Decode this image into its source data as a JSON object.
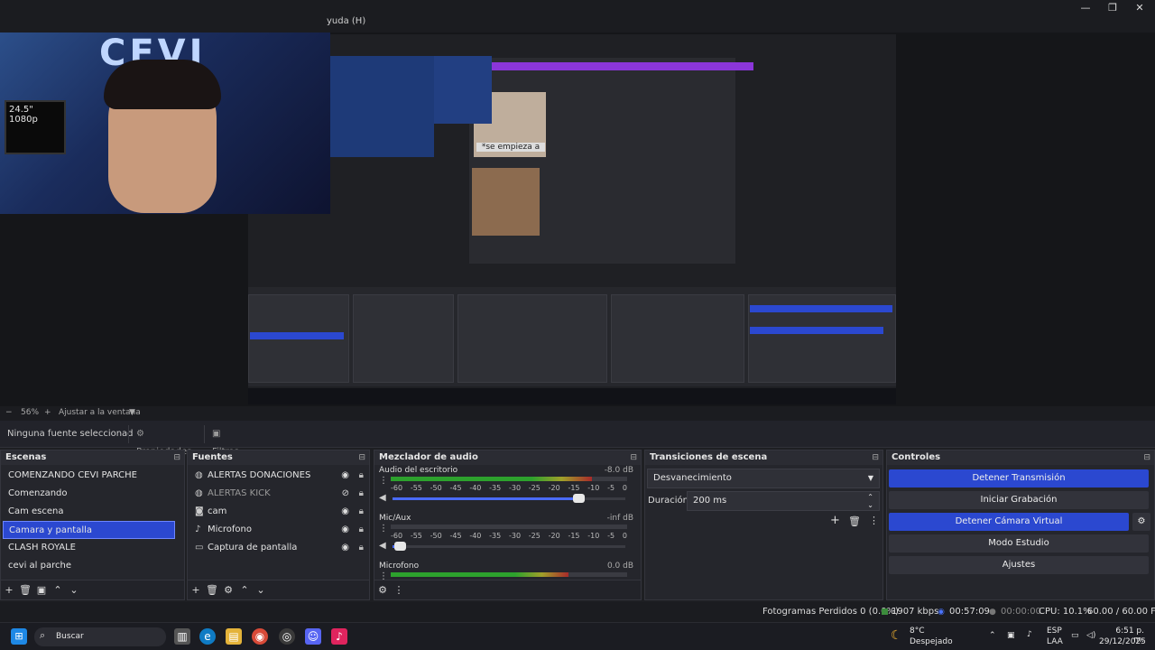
{
  "window": {
    "title_menu_partial": "yuda (H)",
    "controls": [
      "—",
      "❐",
      "✕"
    ]
  },
  "preview": {
    "webcam_overlay_text": "24.5\" 1080p",
    "logo_text": "CEVI",
    "meme_caption": "*se empieza a"
  },
  "zoom_bar": {
    "minus": "−",
    "zoom": "56%",
    "plus": "+",
    "fit_label": "Ajustar a la ventana",
    "dropdown": "▼"
  },
  "source_toolbar": {
    "no_source": "Ninguna fuente seleccionad",
    "properties": "Propiedades",
    "filters": "Filtros"
  },
  "scenes": {
    "title": "Escenas",
    "items": [
      {
        "label": "COMENZANDO CEVI PARCHE"
      },
      {
        "label": "Comenzando"
      },
      {
        "label": "Cam escena"
      },
      {
        "label": "Camara y pantalla"
      },
      {
        "label": "CLASH ROYALE"
      },
      {
        "label": "cevi al parche"
      }
    ],
    "selected": "Camara y pantalla"
  },
  "sources": {
    "title": "Fuentes",
    "items": [
      {
        "label": "ALERTAS DONACIONES",
        "icon": "globe-icon",
        "visible": true
      },
      {
        "label": "ALERTAS KICK",
        "icon": "globe-icon",
        "visible": false
      },
      {
        "label": "cam",
        "icon": "camera-icon",
        "visible": true
      },
      {
        "label": "Microfono",
        "icon": "microphone-icon",
        "visible": true
      },
      {
        "label": "Captura de pantalla",
        "icon": "monitor-icon",
        "visible": true
      }
    ]
  },
  "mixer": {
    "title": "Mezclador de audio",
    "ticks": [
      "-60",
      "-55",
      "-50",
      "-45",
      "-40",
      "-35",
      "-30",
      "-25",
      "-20",
      "-15",
      "-10",
      "-5",
      "0"
    ],
    "channels": [
      {
        "name": "Audio del escritorio",
        "db": "-8.0 dB",
        "level": 0.85,
        "volume": 0.8
      },
      {
        "name": "Mic/Aux",
        "db": "-inf dB",
        "level": 0.0,
        "volume": 0.03
      },
      {
        "name": "Microfono",
        "db": "0.0 dB",
        "level": 0.75,
        "volume": 0.0
      }
    ]
  },
  "transitions": {
    "title": "Transiciones de escena",
    "type": "Desvanecimiento",
    "duration_label": "Duración",
    "duration_value": "200 ms"
  },
  "controls": {
    "title": "Controles",
    "buttons": [
      {
        "label": "Detener Transmisión",
        "active": true
      },
      {
        "label": "Iniciar Grabación",
        "active": false
      },
      {
        "label": "Detener Cámara Virtual",
        "active": true
      },
      {
        "label": "Modo Estudio",
        "active": false
      },
      {
        "label": "Ajustes",
        "active": false
      }
    ]
  },
  "status": {
    "dropped_frames": "Fotogramas Perdidos 0 (0.0%)",
    "bitrate": "1907 kbps",
    "stream_time": "00:57:09",
    "record_time": "00:00:00",
    "cpu": "CPU: 10.1%",
    "fps": "60.00 / 60.00 FPS"
  },
  "taskbar": {
    "search_placeholder": "Buscar",
    "weather_temp": "8°C",
    "weather_desc": "Despejado",
    "lang_top": "ESP",
    "lang_bottom": "LAA",
    "time": "6:51 p. m.",
    "date": "29/12/2025",
    "colors": {
      "accent": "#2b48d0",
      "live_red": "#c0392b"
    }
  }
}
